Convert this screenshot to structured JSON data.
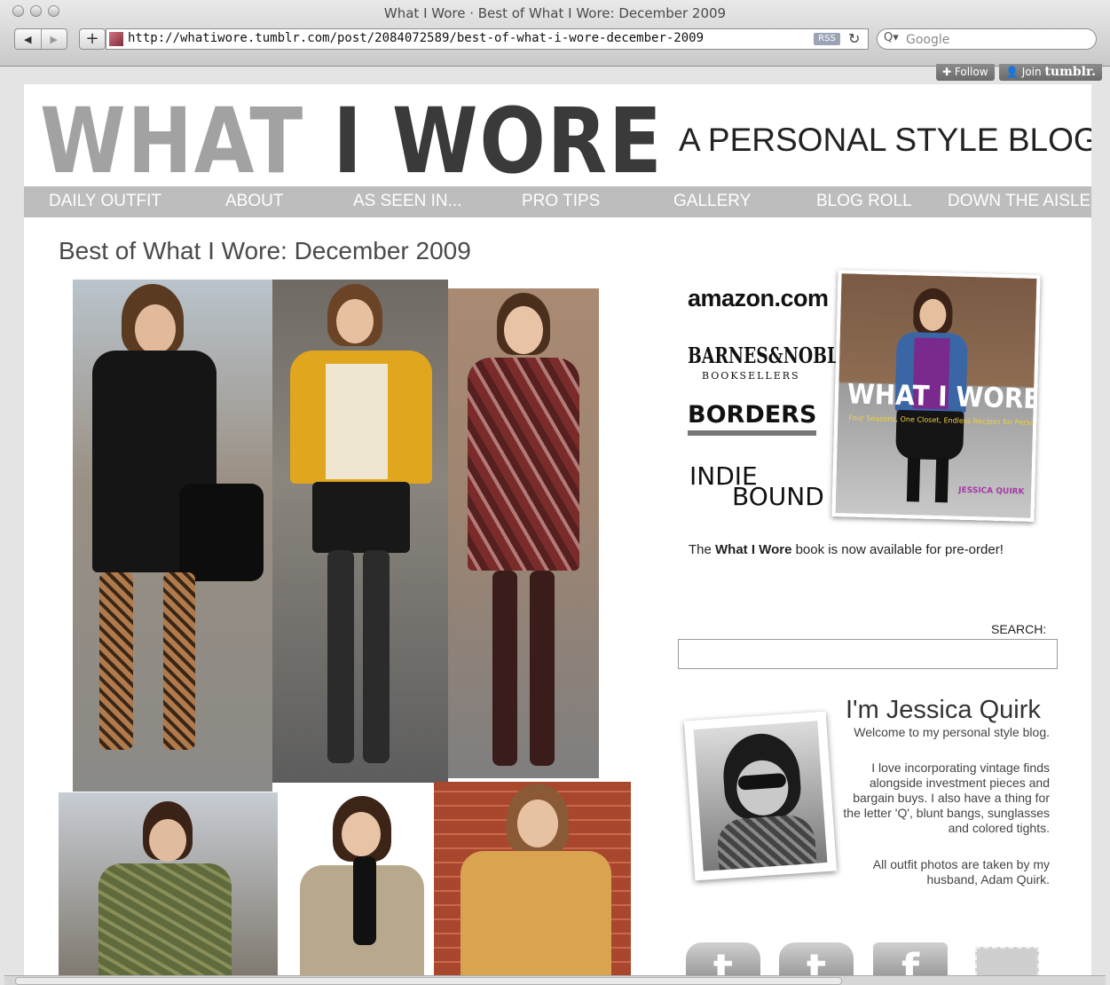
{
  "window": {
    "title": "What I Wore · Best of What I Wore: December 2009"
  },
  "toolbar": {
    "url": "http://whatiwore.tumblr.com/post/2084072589/best-of-what-i-wore-december-2009",
    "rss": "RSS",
    "search_placeholder": "Google"
  },
  "tumblr_bar": {
    "follow": "Follow",
    "join": "Join",
    "brand": "tumblr."
  },
  "header": {
    "logo_light": "WHAT",
    "logo_dark_1": "I",
    "logo_dark_2": "WORE",
    "tagline": "A PERSONAL STYLE BLOG"
  },
  "nav": [
    "DAILY OUTFIT",
    "ABOUT",
    "AS SEEN IN...",
    "PRO TIPS",
    "GALLERY",
    "BLOG ROLL",
    "DOWN THE AISLE"
  ],
  "post": {
    "title": "Best of What I Wore: December 2009"
  },
  "sidebar": {
    "stores": {
      "amazon": "amazon.com",
      "bn_main": "BARNES&NOBLE",
      "bn_sub": "BOOKSELLERS",
      "borders": "BORDERS",
      "indie_1": "INDIE",
      "indie_2": "BOUND"
    },
    "book": {
      "title": "WHAT I WORE",
      "subtitle": "Four Seasons, One Closet, Endless Recipes for Personal Style",
      "author": "JESSICA QUIRK"
    },
    "preorder_pre": "The ",
    "preorder_bold": "What I Wore",
    "preorder_post": " book is now available for pre-order!",
    "search_label": "SEARCH:",
    "about": {
      "title": "I'm Jessica Quirk",
      "welcome": "Welcome to my personal style blog.",
      "bio": "I love incorporating vintage finds alongside investment pieces and bargain buys. I also have a thing for the letter 'Q', blunt bangs, sunglasses and colored tights.",
      "photos": "All outfit photos are taken by my husband, Adam Quirk."
    },
    "social": {
      "twitter": "t",
      "tumblr": "t",
      "facebook": "f"
    }
  },
  "icons": [
    "back-arrow-icon",
    "forward-arrow-icon",
    "plus-icon",
    "reload-icon",
    "search-icon"
  ],
  "colors": {
    "nav_bg": "#bdbdbd",
    "logo_light": "#a2a2a2",
    "logo_dark": "#3a3a3a"
  }
}
